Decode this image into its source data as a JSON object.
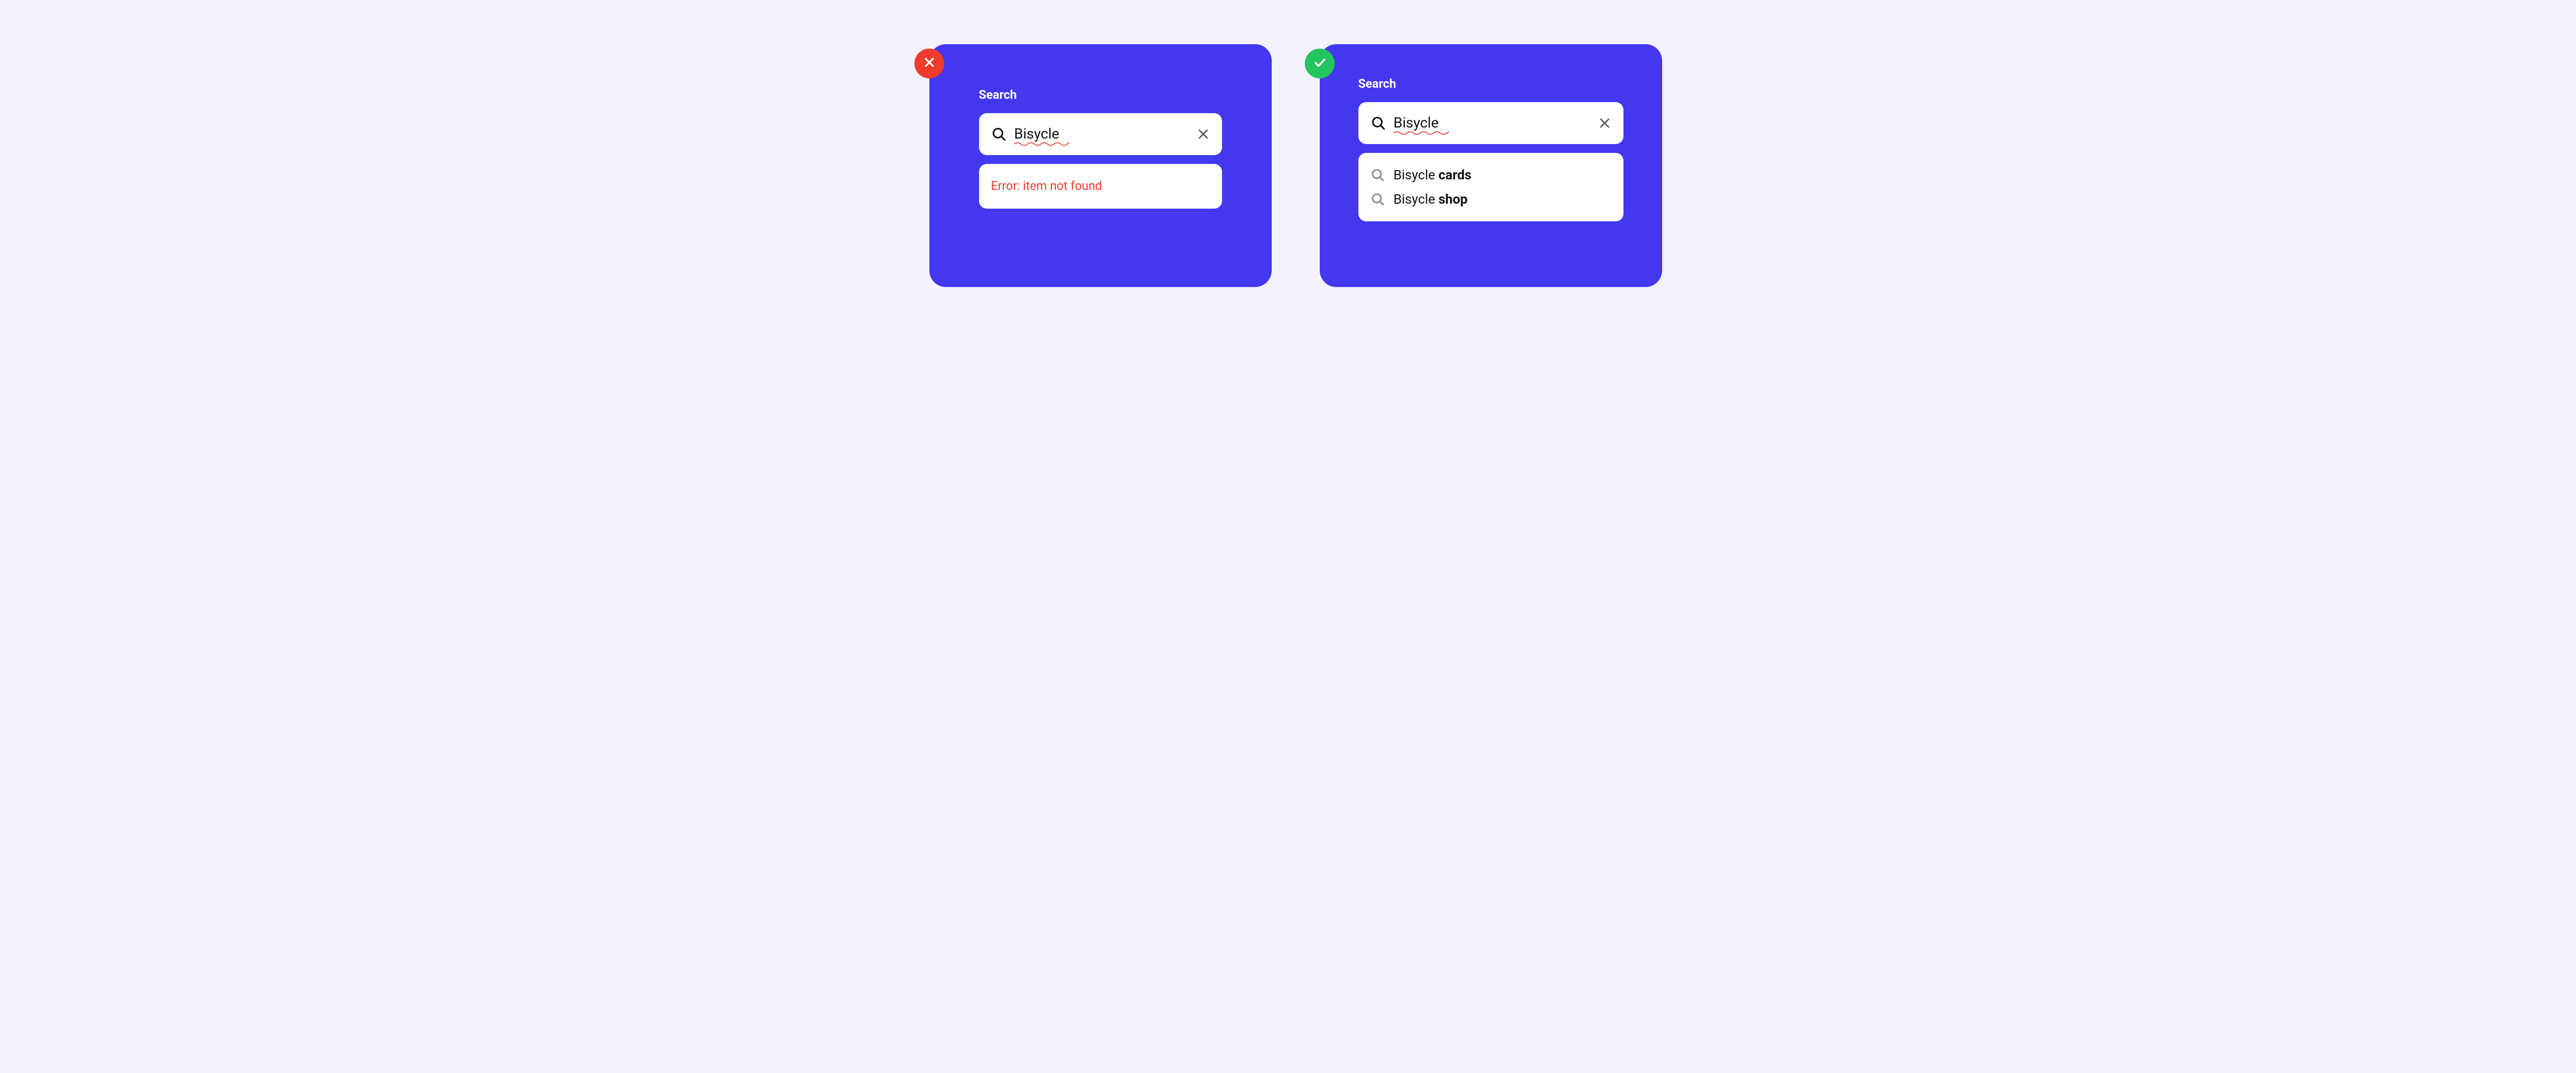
{
  "bad_example": {
    "search_label": "Search",
    "query": "Bisycle",
    "error_message": "Error: item not found"
  },
  "good_example": {
    "search_label": "Search",
    "query": "Bisycle",
    "suggestions": [
      {
        "base": "Bisycle",
        "bold": "cards"
      },
      {
        "base": "Bisycle",
        "bold": "shop"
      }
    ]
  },
  "colors": {
    "panel": "#4338f0",
    "error": "#ef3c2f",
    "success": "#22c55e",
    "page_bg": "#f4f2ff"
  }
}
